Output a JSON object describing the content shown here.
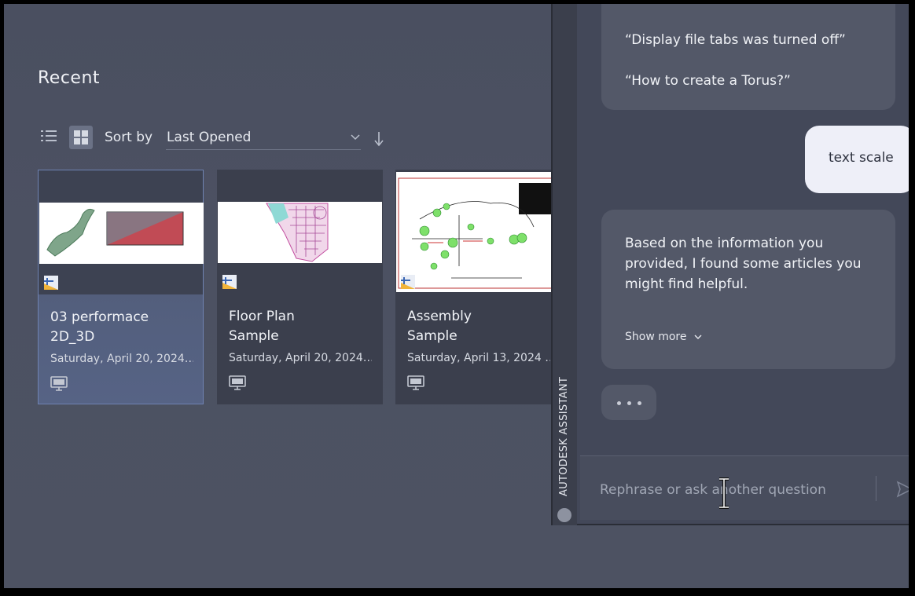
{
  "start_page": {
    "recent_title": "Recent",
    "sort_label": "Sort by",
    "sort_value": "Last Opened",
    "files": [
      {
        "name_line1": "03 performace",
        "name_line2": "2D_3D",
        "date": "Saturday, April 20, 2024…",
        "selected": true
      },
      {
        "name_line1": "Floor Plan",
        "name_line2": "Sample",
        "date": "Saturday, April 20, 2024…",
        "selected": false
      },
      {
        "name_line1": "Assembly",
        "name_line2": "Sample",
        "date": "Saturday, April 13, 2024 …",
        "selected": false
      }
    ]
  },
  "assistant": {
    "panel_title": "AUTODESK ASSISTANT",
    "prev_suggestions": [
      "“Display file tabs was turned off”",
      "“How to create a Torus?”"
    ],
    "user_message": "text scale",
    "reply_text": "Based on the information you provided, I found some articles you might find helpful.",
    "show_more_label": "Show more",
    "input_placeholder": "Rephrase or ask another question"
  },
  "icons": {
    "list_view": "list-view-icon",
    "grid_view": "grid-view-icon",
    "sort_dropdown": "chevron-down-icon",
    "sort_direction": "arrow-down-icon",
    "file_type": "autocad-file-icon",
    "local": "local-computer-icon",
    "send": "send-icon",
    "logo": "autodesk-logo-icon"
  },
  "colors": {
    "background": "#4b5061",
    "panel": "#434859",
    "bubble": "#535868",
    "user_bubble": "#eeeff8",
    "selected_card": "#566385"
  }
}
